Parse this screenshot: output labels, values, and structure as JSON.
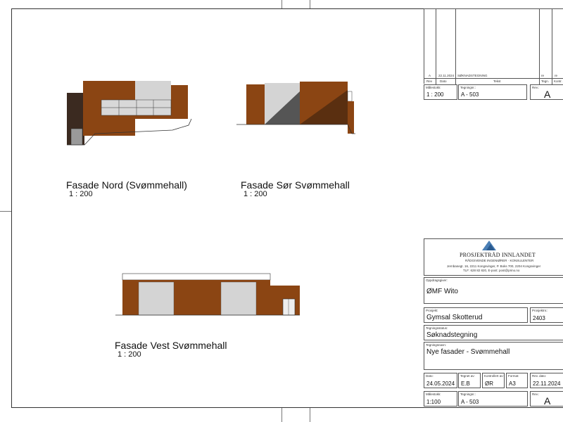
{
  "colors": {
    "wood": "#8B4513",
    "wood_dark": "#5a2c10",
    "panel": "#cfcfcf",
    "shadow": "#3b2a20",
    "line": "#333333"
  },
  "views": {
    "nord": {
      "title": "Fasade Nord (Svømmehall)",
      "scale": "1 : 200"
    },
    "sor": {
      "title": "Fasade Sør Svømmehall",
      "scale": "1 : 200"
    },
    "vest": {
      "title": "Fasade Vest Svømmehall",
      "scale": "1 : 200"
    }
  },
  "revision_table": {
    "rows": [
      {
        "rev": "A",
        "date": "22.11.2024",
        "text": "SØKNADSTEGNING",
        "sign": "re",
        "kontr": "re"
      }
    ],
    "headers": {
      "rev": "Rev",
      "date": "Dato",
      "text": "Tekst",
      "sign": "Tegn.",
      "kontr": "Kontr."
    },
    "malestokk": {
      "label": "Målestokk:",
      "value": "1 : 200"
    },
    "tegningnr": {
      "label": "Tegningnr.:",
      "value": "A - 503"
    },
    "revisjon": {
      "label": "Rev.:",
      "value": "A"
    }
  },
  "company": {
    "name": "PROSJEKTRÅD INNLANDET",
    "tagline": "RÅDGIVENDE INGENIØRER · KONSULENTER",
    "address": "Jernbanegt. 16, 2211 Kongsvinger, P. Boks 700, 2204 Kongsvinger",
    "contact": "TLF: 628 82 820, E-post: post@prino.no"
  },
  "title_block": {
    "oppdragsgiver": {
      "label": "Oppdragsgiver:",
      "value": "ØMF Wito"
    },
    "prosjekt": {
      "label": "Prosjekt:",
      "value": "Gymsal Skotterud"
    },
    "prosjektnr": {
      "label": "Prosjektnr.:",
      "value": "2403"
    },
    "tegningsstatus": {
      "label": "Tegningsstatus:",
      "value": "Søknadstegning"
    },
    "tegningsnavn": {
      "label": "Tegningsnavn:",
      "value": "Nye fasader - Svømmehall"
    },
    "dato": {
      "label": "Dato:",
      "value": "24.05.2024"
    },
    "tegnet_av": {
      "label": "Tegnet av:",
      "value": "E.B"
    },
    "kontrollert_av": {
      "label": "Kontrollert av:",
      "value": "ØR"
    },
    "format": {
      "label": "Format:",
      "value": "A3"
    },
    "rev_dato": {
      "label": "Rev. dato:",
      "value": "22.11.2024"
    },
    "malestokk": {
      "label": "Målestokk:",
      "value": "1:100"
    },
    "tegningnr": {
      "label": "Tegningnr.:",
      "value": "A - 503"
    },
    "rev": {
      "label": "Rev.:",
      "value": "A"
    }
  }
}
